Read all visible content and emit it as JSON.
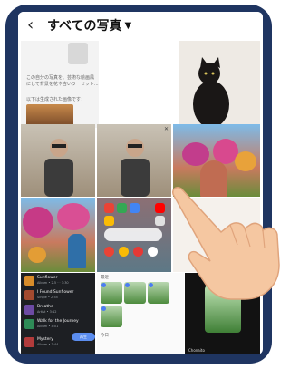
{
  "header": {
    "back_icon": "back-chevron-icon",
    "title": "すべての写真",
    "dropdown_icon": "caret-down-icon"
  },
  "chat_snippets": {
    "line1": "この自分の写真を、芸術な絵画風",
    "line2": "にして背景を花や古いラーセット...",
    "line3": "以下は生成された画像です："
  },
  "music": {
    "songs": [
      {
        "title": "Sunflower",
        "sub": "Album • 2.5 ⋯ 3:30"
      },
      {
        "title": "I Found Sunflower",
        "sub": "Single • 2:55"
      },
      {
        "title": "Breathe",
        "sub": "Artist • 3:12"
      },
      {
        "title": "Walk for the Journey",
        "sub": "Album • 4:01"
      },
      {
        "title": "Mystery",
        "sub": "Album • 3:44"
      }
    ],
    "play_label": "再生"
  },
  "picker": {
    "section_label": "最近",
    "section_label2": "今日"
  },
  "video": {
    "caption": "Chonaito"
  },
  "colors": {
    "tablet_frame": "#1f3561",
    "accent": "#4c7cf3"
  }
}
